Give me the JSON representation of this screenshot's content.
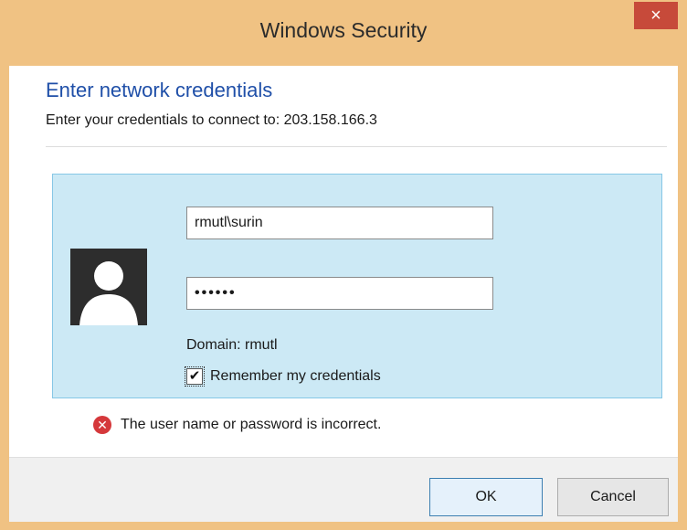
{
  "window": {
    "title": "Windows Security",
    "close_label": "×"
  },
  "dialog": {
    "heading": "Enter network credentials",
    "subheading": "Enter your credentials to connect to: 203.158.166.3"
  },
  "credentials": {
    "username": "rmutl\\surin",
    "password_mask": "••••••",
    "domain_text": "Domain: rmutl",
    "remember_checked": true,
    "remember_label": "Remember my credentials",
    "checkbox_glyph": "✔"
  },
  "error": {
    "icon_glyph": "✕",
    "message": "The user name or password is incorrect."
  },
  "buttons": {
    "ok_label": "OK",
    "cancel_label": "Cancel"
  },
  "colors": {
    "titlebar": "#f0c283",
    "close_button": "#c74a3a",
    "heading_blue": "#1f4fa8",
    "panel_bg": "#cce9f5",
    "panel_border": "#86c7e6",
    "error_red": "#d5383b"
  },
  "icons": {
    "avatar": "user-silhouette-icon",
    "error": "error-circle-icon",
    "close": "close-icon",
    "checkmark": "checkmark-icon"
  }
}
